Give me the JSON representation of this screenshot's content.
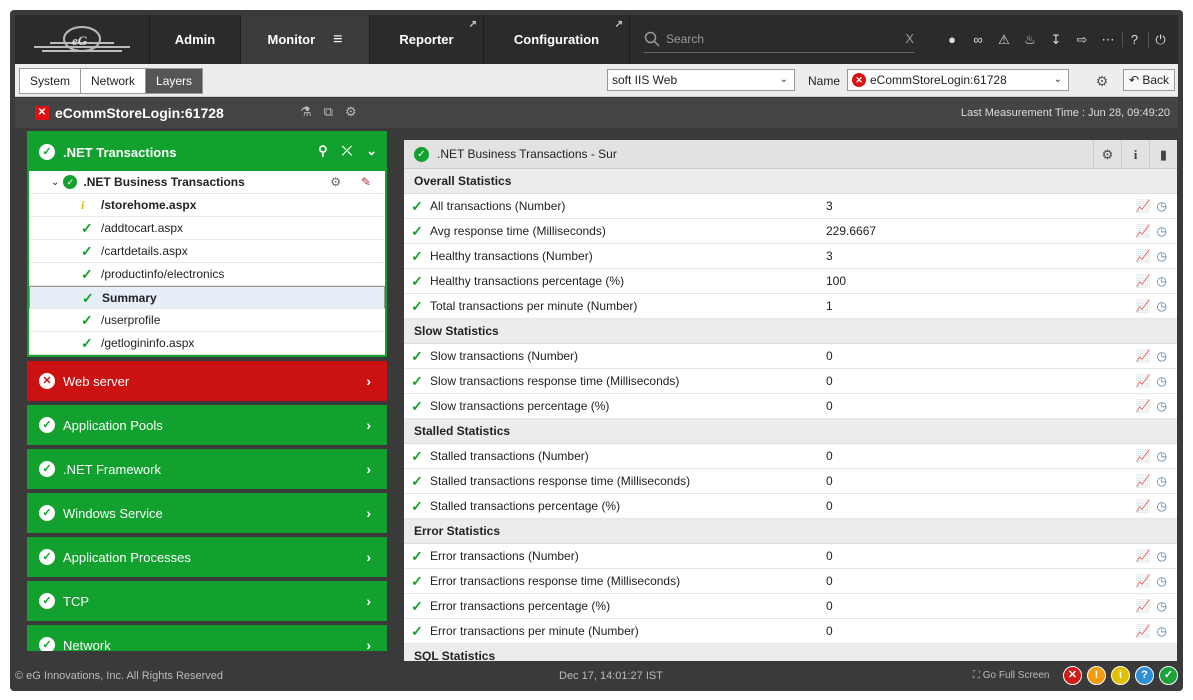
{
  "nav": {
    "items": [
      {
        "label": "Admin"
      },
      {
        "label": "Monitor",
        "menu_icon": "≡"
      },
      {
        "label": "Reporter"
      },
      {
        "label": "Configuration"
      }
    ],
    "search_placeholder": "Search",
    "search_clear": "X"
  },
  "toolbar": {
    "tabs": [
      "System",
      "Network",
      "Layers"
    ],
    "active_tab": "Layers",
    "component_type": "soft IIS Web",
    "name_label": "Name",
    "name_value": "eCommStoreLogin:61728",
    "back_label": "Back"
  },
  "header": {
    "title": "eCommStoreLogin:61728",
    "measurement": "Last Measurement Time : Jun 28, 09:49:20"
  },
  "left": {
    "net_transactions": {
      "label": ".NET Transactions",
      "child": ".NET Business Transactions",
      "items": [
        {
          "label": "/storehome.aspx",
          "status": "info",
          "bold": true
        },
        {
          "label": "/addtocart.aspx",
          "status": "ok"
        },
        {
          "label": "/cartdetails.aspx",
          "status": "ok"
        },
        {
          "label": "/productinfo/electronics",
          "status": "ok"
        },
        {
          "label": "Summary",
          "status": "ok",
          "bold": true,
          "selected": true
        },
        {
          "label": "/userprofile",
          "status": "ok"
        },
        {
          "label": "/getlogininfo.aspx",
          "status": "ok"
        }
      ]
    },
    "groups": [
      {
        "label": "Web server",
        "status": "error"
      },
      {
        "label": "Application Pools",
        "status": "ok"
      },
      {
        "label": ".NET Framework",
        "status": "ok"
      },
      {
        "label": "Windows Service",
        "status": "ok"
      },
      {
        "label": "Application Processes",
        "status": "ok"
      },
      {
        "label": "TCP",
        "status": "ok"
      },
      {
        "label": "Network",
        "status": "ok"
      }
    ]
  },
  "right": {
    "title": ".NET Business Transactions - Sur",
    "sections": [
      {
        "title": "Overall Statistics",
        "rows": [
          {
            "name": "All transactions (Number)",
            "value": "3"
          },
          {
            "name": "Avg response time (Milliseconds)",
            "value": "229.6667"
          },
          {
            "name": "Healthy transactions (Number)",
            "value": "3"
          },
          {
            "name": "Healthy transactions percentage (%)",
            "value": "100"
          },
          {
            "name": "Total transactions per minute (Number)",
            "value": "1"
          }
        ]
      },
      {
        "title": "Slow Statistics",
        "rows": [
          {
            "name": "Slow transactions (Number)",
            "value": "0"
          },
          {
            "name": "Slow transactions response time (Milliseconds)",
            "value": "0"
          },
          {
            "name": "Slow transactions percentage (%)",
            "value": "0"
          }
        ]
      },
      {
        "title": "Stalled Statistics",
        "rows": [
          {
            "name": "Stalled transactions (Number)",
            "value": "0"
          },
          {
            "name": "Stalled transactions response time (Milliseconds)",
            "value": "0"
          },
          {
            "name": "Stalled transactions percentage (%)",
            "value": "0"
          }
        ]
      },
      {
        "title": "Error Statistics",
        "rows": [
          {
            "name": "Error transactions (Number)",
            "value": "0"
          },
          {
            "name": "Error transactions response time (Milliseconds)",
            "value": "0"
          },
          {
            "name": "Error transactions percentage (%)",
            "value": "0"
          },
          {
            "name": "Error transactions per minute (Number)",
            "value": "0"
          }
        ]
      },
      {
        "title": "SQL Statistics",
        "rows": []
      }
    ]
  },
  "footer": {
    "copyright": "© eG Innovations, Inc. All Rights Reserved",
    "datetime": "Dec 17, 14:01:27 IST",
    "fullscreen": "Go Full Screen",
    "status_dots": [
      {
        "glyph": "✕",
        "color": "#d11a1a"
      },
      {
        "glyph": "!",
        "color": "#f39c12"
      },
      {
        "glyph": "i",
        "color": "#e0c000"
      },
      {
        "glyph": "?",
        "color": "#2d8fd5"
      },
      {
        "glyph": "✓",
        "color": "#1aa33a"
      }
    ]
  },
  "colors": {
    "ok": "#12a12e",
    "error": "#cc1112",
    "accent": "#4a7aaf"
  }
}
